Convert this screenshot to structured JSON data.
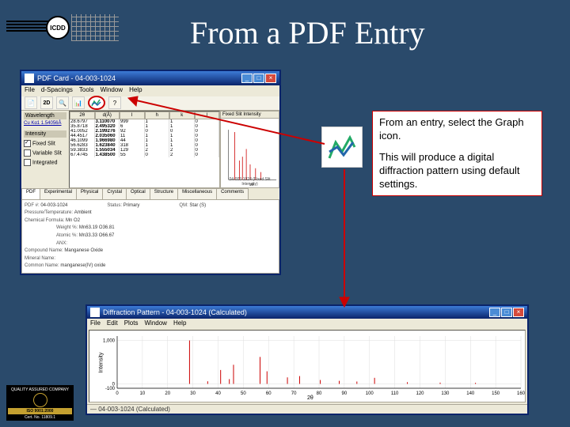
{
  "slide": {
    "title": "From a PDF Entry"
  },
  "logo": {
    "text": "ICDD"
  },
  "callout": {
    "p1": "From an entry, select the Graph icon.",
    "p2": "This will produce a digital diffraction pattern using default settings."
  },
  "pdfcard": {
    "title": "PDF Card - 04-003-1024",
    "menus": [
      "File",
      "d-Spacings",
      "Tools",
      "Window",
      "Help"
    ],
    "toolbar": {
      "twod": "2D"
    },
    "wavelength_label": "Wavelength",
    "wavelength_value": "Cu Kα1 1.54056Å",
    "intensity_label": "Intensity",
    "checks": {
      "fixed": "Fixed Slit",
      "variable": "Variable Slit",
      "integrated": "Integrated"
    },
    "cols": [
      "2θ",
      "d(Å)",
      "I",
      "h",
      "k",
      "l"
    ],
    "rows": [
      [
        "28.6797",
        "3.110070",
        "999",
        "1",
        "1",
        "0"
      ],
      [
        "35.8718",
        "2.495320",
        "6",
        "1",
        "1",
        "0"
      ],
      [
        "41.0052",
        "2.199276",
        "92",
        "0",
        "0",
        "0"
      ],
      [
        "44.4517",
        "2.035060",
        "11",
        "1",
        "1",
        "0"
      ],
      [
        "46.1099",
        "1.966980",
        "44",
        "1",
        "1",
        "0"
      ],
      [
        "56.6283",
        "1.623840",
        "318",
        "1",
        "1",
        "0"
      ],
      [
        "59.3833",
        "1.555034",
        "129",
        "2",
        "2",
        "0"
      ],
      [
        "67.4745",
        "1.438500",
        "55",
        "0",
        "2",
        "0"
      ]
    ],
    "mini_axis": "2θ",
    "mini_caption": "04-003-1024 (Fixed Slit Intensity)",
    "graph_hdr": "Fixed Slit Intensity",
    "tabs": [
      "PDF",
      "Experimental",
      "Physical",
      "Crystal",
      "Optical",
      "Structure",
      "Miscellaneous",
      "Comments"
    ],
    "details": {
      "pdfnum_l": "PDF #:",
      "pdfnum_v": "04-003-1024",
      "status_l": "Status:",
      "status_v": "Primary",
      "qm_l": "QM:",
      "qm_v": "Star (S)",
      "press_l": "Pressure/Temperature:",
      "press_v": "Ambient",
      "chem_l": "Chemical Formula:",
      "chem_v": "Mn O2",
      "wt_l": "Weight %:",
      "wt_v": "Mn63.19 O36.81",
      "at_l": "Atomic %:",
      "at_v": "Mn33.33 O66.67",
      "anx_l": "ANX:",
      "comp_l": "Compound Name:",
      "comp_v": "Manganese Oxide",
      "min_l": "Mineral Name:",
      "common_l": "Common Name:",
      "common_v": "manganese(IV) oxide"
    }
  },
  "diffr": {
    "title": "Diffraction Pattern - 04-003-1024 (Calculated)",
    "menus": [
      "File",
      "Edit",
      "Plots",
      "Window",
      "Help"
    ],
    "ylabel": "Intensity",
    "xlabel": "2θ",
    "status": "— 04-003-1024 (Calculated)",
    "xticks": [
      "0",
      "10",
      "20",
      "30",
      "40",
      "50",
      "60",
      "70",
      "80",
      "90",
      "100",
      "110",
      "120",
      "130",
      "140",
      "150",
      "160"
    ],
    "yticks": [
      "-100",
      "0",
      "1,000"
    ]
  },
  "chart_data": {
    "type": "bar",
    "title": "Diffraction Pattern - 04-003-1024 (Calculated)",
    "xlabel": "2θ",
    "ylabel": "Intensity",
    "xlim": [
      0,
      160
    ],
    "ylim": [
      -100,
      1100
    ],
    "categories": [
      28.68,
      35.87,
      41.0,
      44.45,
      46.11,
      56.63,
      59.38,
      67.47,
      72.3,
      80.5,
      88.0,
      95.0,
      102.0,
      115.0,
      128.0,
      142.0
    ],
    "values": [
      999,
      60,
      320,
      110,
      440,
      620,
      290,
      150,
      180,
      90,
      70,
      55,
      140,
      40,
      30,
      25
    ],
    "x_ticks": [
      0,
      10,
      20,
      30,
      40,
      50,
      60,
      70,
      80,
      90,
      100,
      110,
      120,
      130,
      140,
      150,
      160
    ],
    "y_ticks": [
      -100,
      0,
      1000
    ]
  },
  "badge": {
    "l1": "QUALITY ASSURED COMPANY",
    "l2": "ISO 9001:2000",
    "l3": "Cert. No. 11809.1"
  }
}
